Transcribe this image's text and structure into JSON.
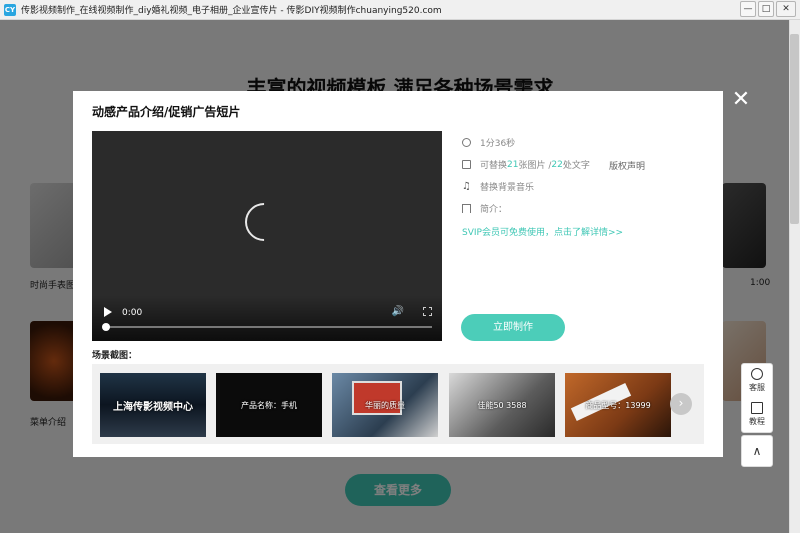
{
  "window": {
    "title": "传影视频制作_在线视频制作_diy婚礼视频_电子相册_企业宣传片 - 传影DIY视频制作chuanying520.com",
    "app_icon_text": "CY",
    "min_label": "—",
    "max_label": "□",
    "close_label": "✕"
  },
  "page": {
    "heading": "丰富的视频模板 满足各种场景需求",
    "cards": [
      {
        "label": "时尚手表图"
      },
      {
        "label": "菜单介绍"
      }
    ],
    "right_duration": "1:00",
    "more_button": "查看更多",
    "side_tools": [
      {
        "label": "客服",
        "icon": "headset-icon"
      },
      {
        "label": "教程",
        "icon": "book-icon"
      }
    ],
    "back_top": "∧"
  },
  "modal": {
    "close_label": "✕",
    "title": "动感产品介绍/促销广告短片",
    "player": {
      "time": "0:00",
      "volume_icon": "🔊"
    },
    "info": {
      "duration": "1分36秒",
      "replace_pre": "可替换",
      "replace_images": "21",
      "replace_mid": "张图片 / ",
      "replace_texts": "22",
      "replace_post": "处文字",
      "copyright": "版权声明",
      "music": "替换背景音乐",
      "intro": "简介：",
      "svip": "SVIP会员可免费使用，点击了解详情>>"
    },
    "make_button": "立即制作",
    "scene_label": "场景截图：",
    "thumbs": [
      {
        "text": "上海传影视频中心"
      },
      {
        "text": "产品名称：手机"
      },
      {
        "text": "华丽的质量"
      },
      {
        "text": "佳能50 3588"
      },
      {
        "text": "商品型号：13999"
      }
    ],
    "next_label": "›"
  }
}
